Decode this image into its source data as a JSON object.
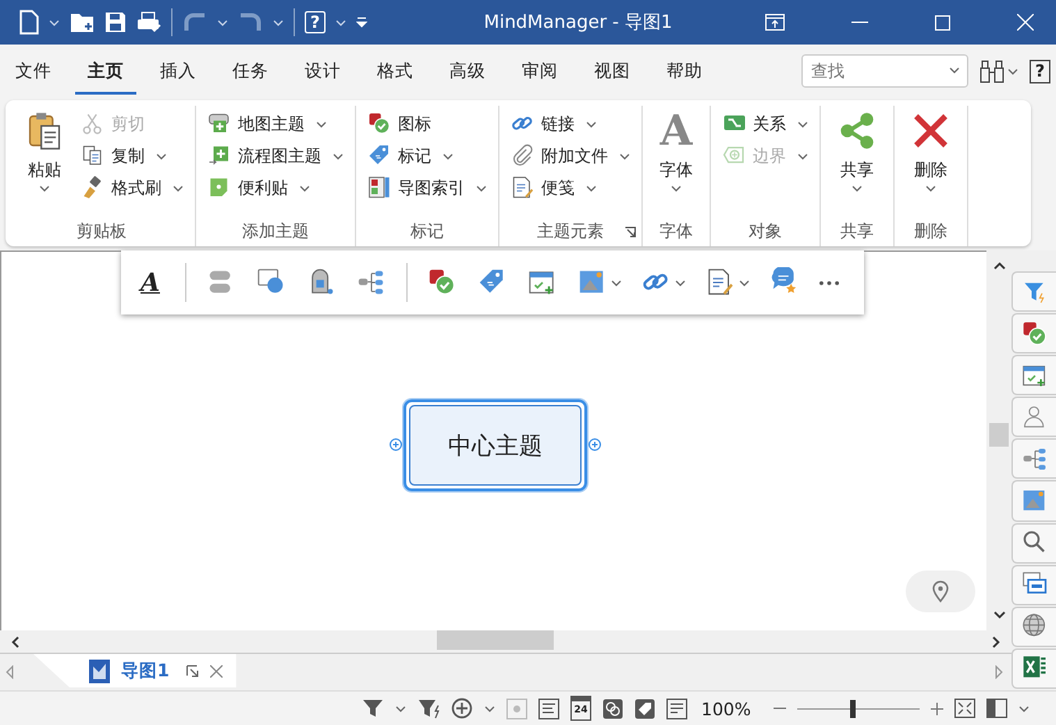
{
  "title_bar": {
    "title": "MindManager - 导图1",
    "help_glyph": "?"
  },
  "menu_tabs": [
    {
      "label": "文件",
      "selected": false
    },
    {
      "label": "主页",
      "selected": true
    },
    {
      "label": "插入",
      "selected": false
    },
    {
      "label": "任务",
      "selected": false
    },
    {
      "label": "设计",
      "selected": false
    },
    {
      "label": "格式",
      "selected": false
    },
    {
      "label": "高级",
      "selected": false
    },
    {
      "label": "审阅",
      "selected": false
    },
    {
      "label": "视图",
      "selected": false
    },
    {
      "label": "帮助",
      "selected": false
    }
  ],
  "search": {
    "placeholder": "查找"
  },
  "ribbon_help_glyph": "?",
  "ribbon_groups": [
    {
      "label": "剪贴板",
      "items": [
        {
          "label": "粘贴",
          "kind": "large",
          "dropdown": true,
          "disabled": false
        },
        {
          "label": "剪切",
          "kind": "small",
          "dropdown": false,
          "disabled": true
        },
        {
          "label": "复制",
          "kind": "small",
          "dropdown": true,
          "disabled": false
        },
        {
          "label": "格式刷",
          "kind": "small",
          "dropdown": true,
          "disabled": false
        }
      ]
    },
    {
      "label": "添加主题",
      "items": [
        {
          "label": "地图主题",
          "kind": "small",
          "dropdown": true,
          "disabled": false
        },
        {
          "label": "流程图主题",
          "kind": "small",
          "dropdown": true,
          "disabled": false
        },
        {
          "label": "便利贴",
          "kind": "small",
          "dropdown": true,
          "disabled": false
        }
      ]
    },
    {
      "label": "标记",
      "items": [
        {
          "label": "图标",
          "kind": "small",
          "dropdown": false,
          "disabled": false
        },
        {
          "label": "标记",
          "kind": "small",
          "dropdown": true,
          "disabled": false
        },
        {
          "label": "导图索引",
          "kind": "small",
          "dropdown": true,
          "disabled": false
        }
      ]
    },
    {
      "label": "主题元素",
      "launcher": true,
      "items": [
        {
          "label": "链接",
          "kind": "small",
          "dropdown": true,
          "disabled": false
        },
        {
          "label": "附加文件",
          "kind": "small",
          "dropdown": true,
          "disabled": false
        },
        {
          "label": "便笺",
          "kind": "small",
          "dropdown": true,
          "disabled": false
        }
      ]
    },
    {
      "label": "字体",
      "items": [
        {
          "label": "字体",
          "kind": "large",
          "dropdown": true,
          "disabled": false,
          "glyph": "A"
        }
      ]
    },
    {
      "label": "对象",
      "items": [
        {
          "label": "关系",
          "kind": "small",
          "dropdown": true,
          "disabled": false
        },
        {
          "label": "边界",
          "kind": "small",
          "dropdown": true,
          "disabled": true
        }
      ]
    },
    {
      "label": "共享",
      "items": [
        {
          "label": "共享",
          "kind": "large",
          "dropdown": true,
          "disabled": false
        }
      ]
    },
    {
      "label": "删除",
      "items": [
        {
          "label": "删除",
          "kind": "large",
          "dropdown": true,
          "disabled": false
        }
      ]
    }
  ],
  "floating_toolbar": {
    "format_glyph": "A",
    "groups": [
      {
        "buttons": [
          {
            "dropdown": false
          },
          {
            "dropdown": false
          },
          {
            "dropdown": false
          },
          {
            "dropdown": false
          }
        ]
      },
      {
        "buttons": [
          {
            "dropdown": false
          },
          {
            "dropdown": false
          },
          {
            "dropdown": false
          },
          {
            "dropdown": true
          },
          {
            "dropdown": true
          },
          {
            "dropdown": true
          },
          {
            "dropdown": false
          },
          {
            "dropdown": false
          }
        ]
      }
    ]
  },
  "canvas": {
    "central_topic": {
      "label": "中心主题",
      "selected": true
    }
  },
  "document_tabs": [
    {
      "label": "导图1",
      "selected": true
    }
  ],
  "status_bar": {
    "calendar_day": "24",
    "zoom": "100%",
    "zoom_slider": {
      "level": 0.46
    }
  }
}
